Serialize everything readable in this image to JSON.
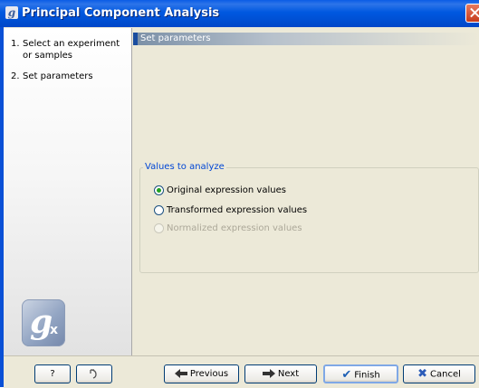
{
  "window": {
    "title": "Principal Component Analysis",
    "app_icon_glyph": "g",
    "close_icon": "close-icon"
  },
  "sidebar": {
    "steps": [
      {
        "number": "1.",
        "label": "Select an experiment or samples"
      },
      {
        "number": "2.",
        "label": "Set parameters"
      }
    ],
    "logo": {
      "glyph": "g",
      "subscript": "x"
    }
  },
  "content": {
    "section_title": "Set parameters",
    "group": {
      "title": "Values to analyze",
      "options": [
        {
          "label": "Original expression values",
          "checked": true,
          "enabled": true
        },
        {
          "label": "Transformed expression values",
          "checked": false,
          "enabled": true
        },
        {
          "label": "Normalized expression values",
          "checked": false,
          "enabled": false
        }
      ]
    }
  },
  "footer": {
    "help_label": "?",
    "reset_icon": "reset-icon",
    "previous_label": "Previous",
    "next_label": "Next",
    "finish_label": "Finish",
    "cancel_label": "Cancel"
  },
  "colors": {
    "titlebar": "#0058e0",
    "group_title": "#0046d5",
    "window_bg": "#ece9d8"
  }
}
